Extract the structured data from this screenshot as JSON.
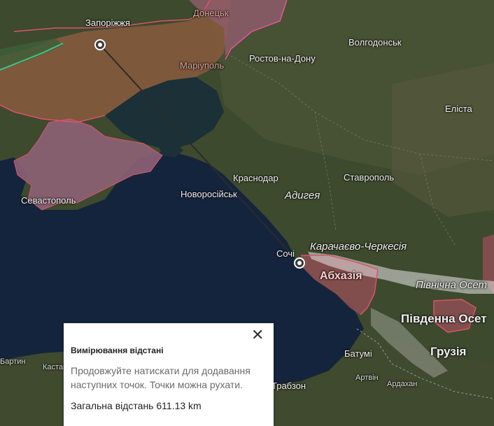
{
  "labels": {
    "zaporizhzhia": "Запоріжжя",
    "donetsk": "Донецьк",
    "volgodonsk": "Волгодонськ",
    "rostov": "Ростов-на-Дону",
    "mariupol": "Маріуполь",
    "elista": "Еліста",
    "krasnodar": "Краснодар",
    "stavropol": "Ставрополь",
    "sevastopol": "Севастополь",
    "novorossiysk": "Новоросійськ",
    "adygea": "Адигея",
    "karachay": "Карачаєво-Черкесія",
    "sochi": "Сочі",
    "abkhazia": "Абхазія",
    "north_ossetia": "Північна Осет",
    "south_ossetia": "Південна Осет",
    "georgia": "Грузія",
    "batumi": "Батумі",
    "artvin": "Артвін",
    "ardahan": "Ардахан",
    "trabzon": "Трабзон",
    "bartin": "Бартин",
    "kastamonu": "Кастам"
  },
  "colors": {
    "sea": "#16253d",
    "land": "#3b4a2b",
    "occupied": "#8a5a3e",
    "crimea": "#8e6277",
    "border": "#d9536b",
    "mountains": "#e8e8e8",
    "measure_line": "#2b2b2b"
  },
  "measure_panel": {
    "title": "Вимірювання відстані",
    "hint": "Продовжуйте натискати для додавання наступних точок. Точки можна рухати.",
    "total_label": "Загальна відстань 611.13 km",
    "close_icon": "close-icon"
  },
  "measure": {
    "start": "Запоріжжя",
    "end": "Сочі",
    "distance_km": 611.13
  }
}
